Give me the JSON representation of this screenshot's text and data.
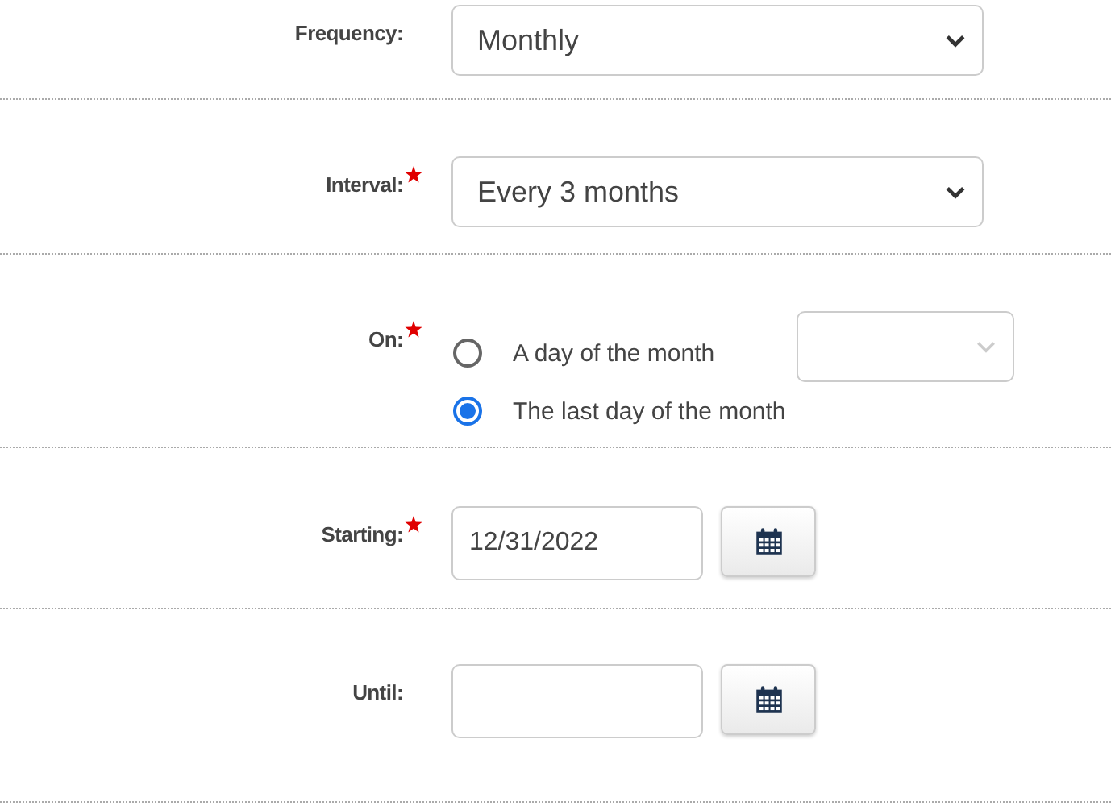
{
  "fields": [
    {
      "kind": "select",
      "label": "Frequency:",
      "required": false,
      "value": "Monthly"
    },
    {
      "kind": "select",
      "label": "Interval:",
      "required": true,
      "value": "Every 3 months"
    },
    {
      "kind": "radio",
      "label": "On:",
      "required": true,
      "options": [
        {
          "label": "A day of the month",
          "selected": false
        },
        {
          "label": "The last day of the month",
          "selected": true
        }
      ],
      "day_select": {
        "disabled": true
      }
    },
    {
      "kind": "date",
      "label": "Starting:",
      "required": true,
      "value": "12/31/2022"
    },
    {
      "kind": "date",
      "label": "Until:",
      "required": false
    }
  ]
}
